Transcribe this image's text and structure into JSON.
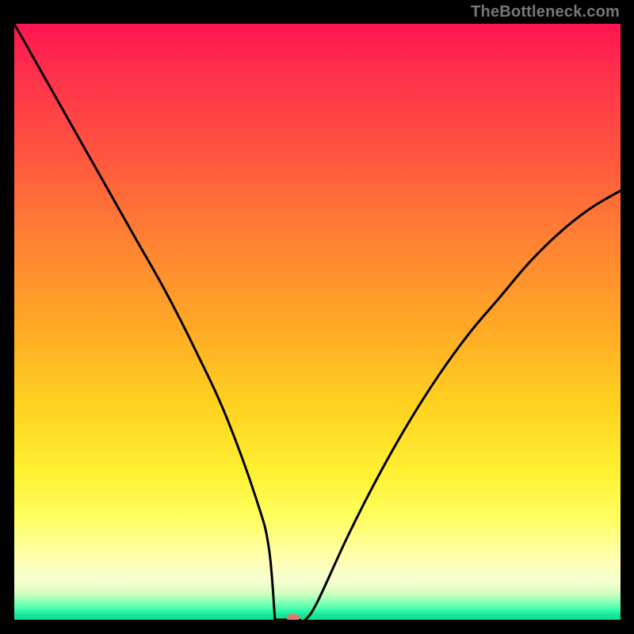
{
  "watermark": "TheBottleneck.com",
  "colors": {
    "frame": "#000000",
    "watermark": "#777777",
    "curve": "#000000",
    "dot": "#e47a6f"
  },
  "chart_data": {
    "type": "line",
    "title": "",
    "xlabel": "",
    "ylabel": "",
    "xlim": [
      0,
      100
    ],
    "ylim": [
      0,
      100
    ],
    "annotations": [],
    "series": [
      {
        "name": "bottleneck-curve",
        "x": [
          0,
          5,
          10,
          15,
          20,
          25,
          30,
          35,
          40,
          42,
          44,
          46,
          48,
          50,
          55,
          60,
          65,
          70,
          75,
          80,
          85,
          90,
          95,
          100
        ],
        "y": [
          100,
          91,
          82,
          73,
          64,
          55,
          45,
          34,
          20,
          12,
          5,
          0,
          0,
          3,
          14,
          24,
          33,
          41,
          48,
          54,
          60,
          65,
          69,
          72
        ]
      }
    ],
    "flat_bottom": {
      "x_start": 43,
      "x_end": 47,
      "y": 0
    },
    "marker": {
      "x": 46,
      "y": 0,
      "shape": "rounded-rect"
    }
  }
}
